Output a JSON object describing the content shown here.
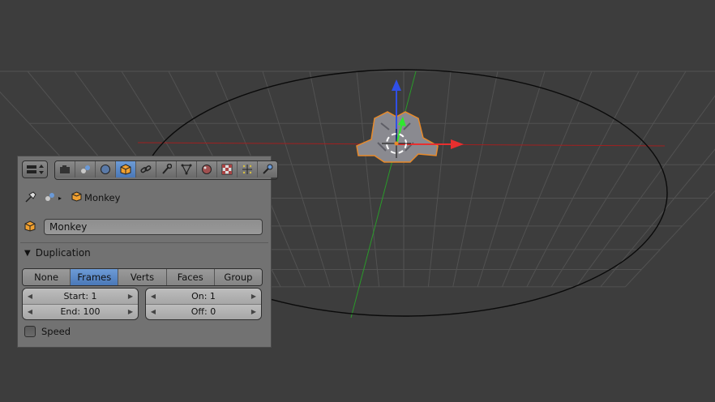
{
  "viewport": {
    "colors": {
      "background": "#3d3d3d",
      "grid": "#505050",
      "x_axis": "#a02020",
      "y_axis": "#2a9a2a",
      "selection": "#e88a2a"
    }
  },
  "properties_panel": {
    "view_switch_icon": "view-layout-icon",
    "tabs": [
      {
        "icon": "render-camera-icon",
        "active": false
      },
      {
        "icon": "render-layers-icon",
        "active": false
      },
      {
        "icon": "scene-icon",
        "active": false
      },
      {
        "icon": "world-icon",
        "active": false
      },
      {
        "icon": "object-cube-icon",
        "active": true
      },
      {
        "icon": "constraints-link-icon",
        "active": false
      },
      {
        "icon": "modifiers-wrench-icon",
        "active": false
      },
      {
        "icon": "data-mesh-icon",
        "active": false
      },
      {
        "icon": "material-icon",
        "active": false
      },
      {
        "icon": "texture-icon",
        "active": false
      },
      {
        "icon": "particles-icon",
        "active": false
      },
      {
        "icon": "physics-icon",
        "active": false
      }
    ],
    "breadcrumb": {
      "object_name": "Monkey"
    },
    "object_name_field": "Monkey",
    "section_title": "Duplication",
    "duplication_options": [
      "None",
      "Frames",
      "Verts",
      "Faces",
      "Group"
    ],
    "duplication_selected": "Frames",
    "fields": {
      "start": "Start: 1",
      "end": "End: 100",
      "on": "On: 1",
      "off": "Off: 0"
    },
    "speed_label": "Speed",
    "speed_checked": false,
    "colors": {
      "panel_bg": "#727272",
      "active_accent": "#5a88c8"
    }
  }
}
